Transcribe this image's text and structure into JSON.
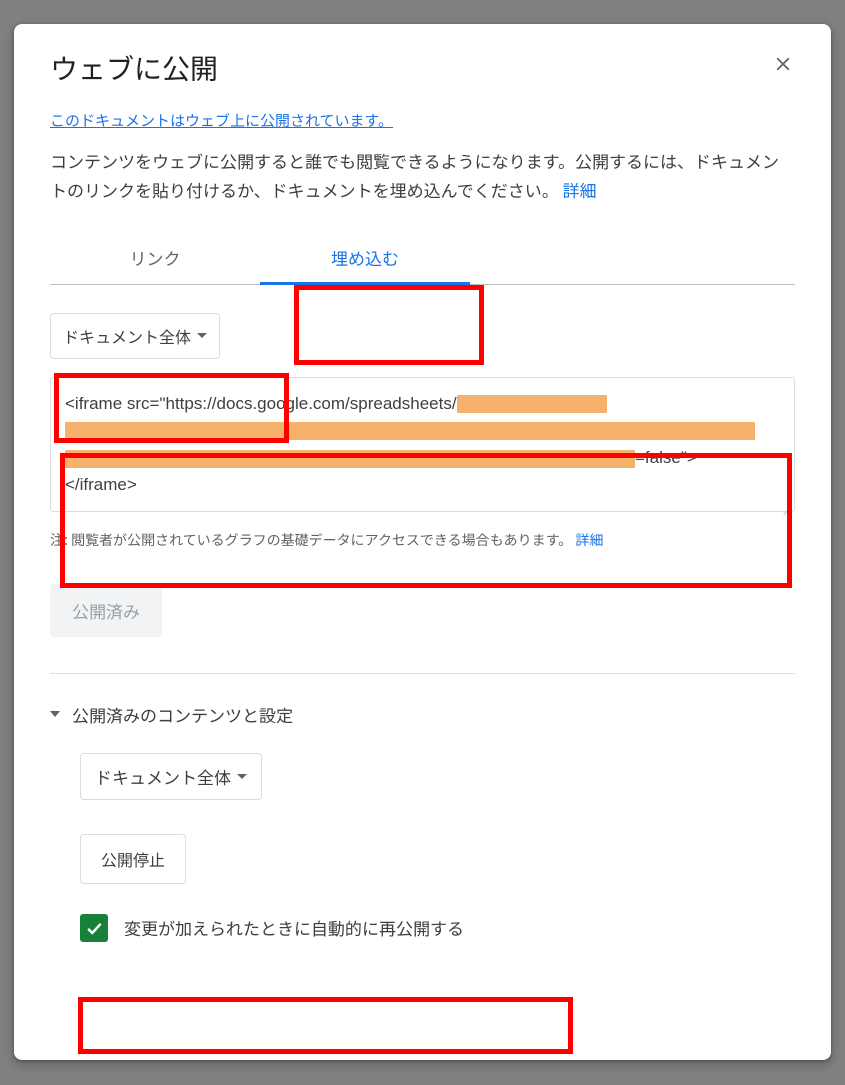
{
  "dialog": {
    "title": "ウェブに公開",
    "published_notice": "このドキュメントはウェブ上に公開されています。",
    "description_text": "コンテンツをウェブに公開すると誰でも閲覧できるようになります。公開するには、ドキュメントのリンクを貼り付けるか、ドキュメントを埋め込んでください。",
    "description_link": "詳細"
  },
  "tabs": {
    "link": "リンク",
    "embed": "埋め込む",
    "active": "embed"
  },
  "scope_dropdown": {
    "selected": "ドキュメント全体"
  },
  "embed_code": {
    "prefix": "<iframe src=\"https://docs.google.com/spreadsheets/",
    "suffix_before_close": "=false\">",
    "closing": "</iframe>"
  },
  "footnote": {
    "text": "注: 閲覧者が公開されているグラフの基礎データにアクセスできる場合もあります。",
    "link": "詳細"
  },
  "published_button": "公開済み",
  "settings": {
    "header": "公開済みのコンテンツと設定",
    "scope_selected": "ドキュメント全体",
    "stop_button": "公開停止",
    "auto_republish_label": "変更が加えられたときに自動的に再公開する",
    "auto_republish_checked": true
  }
}
